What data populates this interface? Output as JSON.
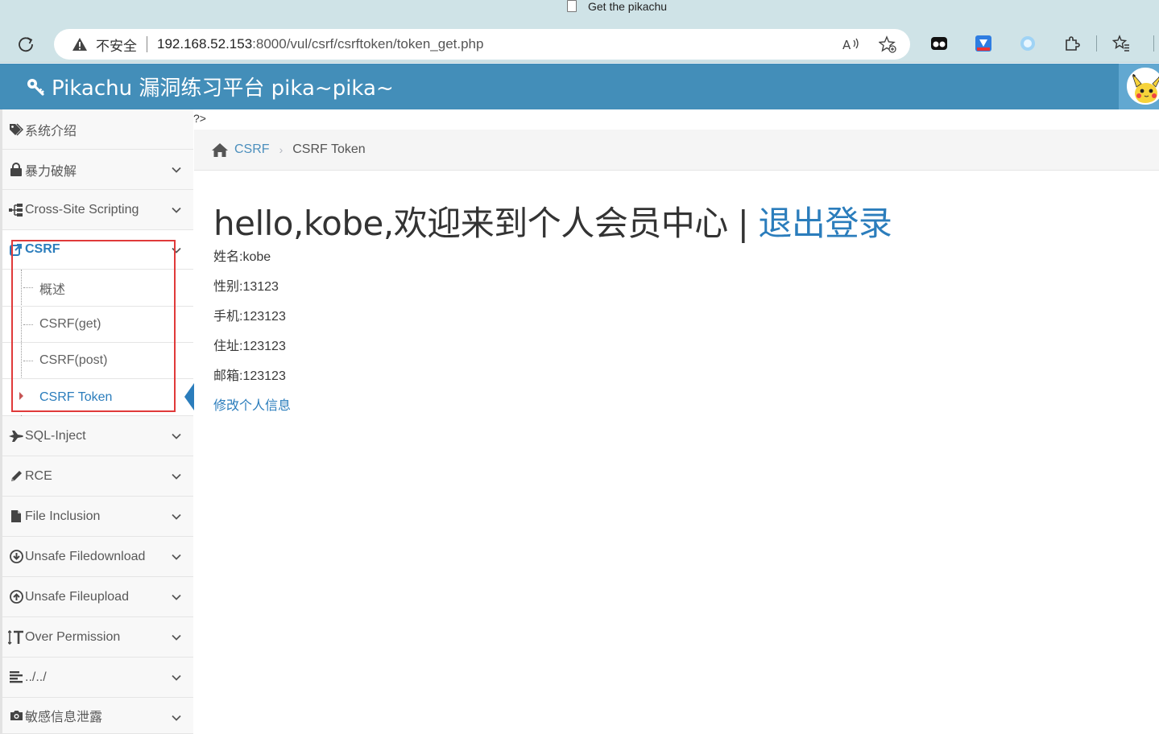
{
  "browser": {
    "tab_title": "Get the pikachu",
    "insecure_label": "不安全",
    "url_host": "192.168.52.153",
    "url_rest": ":8000/vul/csrf/csrftoken/token_get.php"
  },
  "header": {
    "brand": "Pikachu 漏洞练习平台 pika~pika~"
  },
  "sidebar": {
    "items": [
      {
        "label": "系统介绍",
        "icon": "tags-icon"
      },
      {
        "label": "暴力破解",
        "icon": "lock-icon"
      },
      {
        "label": "Cross-Site Scripting",
        "icon": "sitemap-icon"
      },
      {
        "label": "CSRF",
        "icon": "share-icon"
      },
      {
        "label": "SQL-Inject",
        "icon": "fighter-jet-icon"
      },
      {
        "label": "RCE",
        "icon": "pencil-icon"
      },
      {
        "label": "File Inclusion",
        "icon": "file-icon"
      },
      {
        "label": "Unsafe Filedownload",
        "icon": "download-icon"
      },
      {
        "label": "Unsafe Fileupload",
        "icon": "upload-icon"
      },
      {
        "label": "Over Permission",
        "icon": "text-height-icon"
      },
      {
        "label": "../../",
        "icon": "align-left-icon"
      },
      {
        "label": "敏感信息泄露",
        "icon": "camera-icon"
      }
    ],
    "csrf_sub": [
      {
        "label": "概述"
      },
      {
        "label": "CSRF(get)"
      },
      {
        "label": "CSRF(post)"
      },
      {
        "label": "CSRF Token"
      }
    ]
  },
  "main": {
    "stray_text": "?>",
    "breadcrumb": {
      "link": "CSRF",
      "current": "CSRF Token"
    },
    "heading": {
      "greeting": "hello,kobe,欢迎来到个人会员中心",
      "separator": "|",
      "logout": "退出登录"
    },
    "info": [
      "姓名:kobe",
      "性别:13123",
      "手机:123123",
      "住址:123123",
      "邮箱:123123"
    ],
    "edit_link": "修改个人信息"
  },
  "colors": {
    "header_bg": "#438eb9",
    "accent": "#2b7dbc",
    "highlight_box": "#e03a3a"
  }
}
